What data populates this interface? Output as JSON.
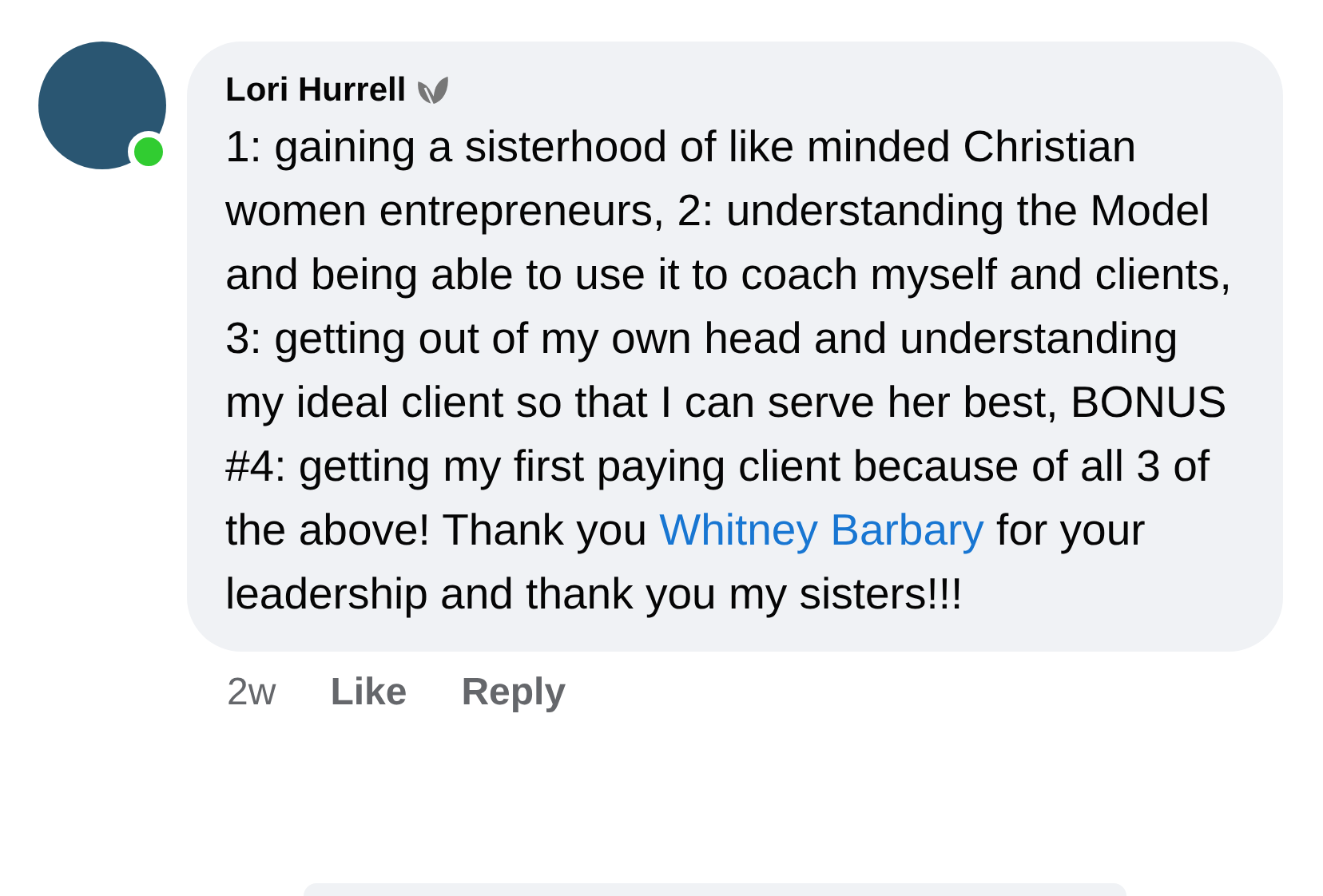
{
  "comment": {
    "author": "Lori Hurrell",
    "online": true,
    "body_before": "1: gaining a sisterhood of like minded Christian women entrepreneurs, 2: understanding the Model and being able to use it to coach myself and clients, 3: getting out of my own head and understanding my ideal client so that I can serve her best, BONUS #4: getting my first paying client because of all 3 of the above!  Thank you ",
    "mention": "Whitney Barbary",
    "body_after": " for your leadership and thank you my sisters!!!",
    "time": "2w",
    "actions": [
      "Like",
      "Reply"
    ]
  }
}
